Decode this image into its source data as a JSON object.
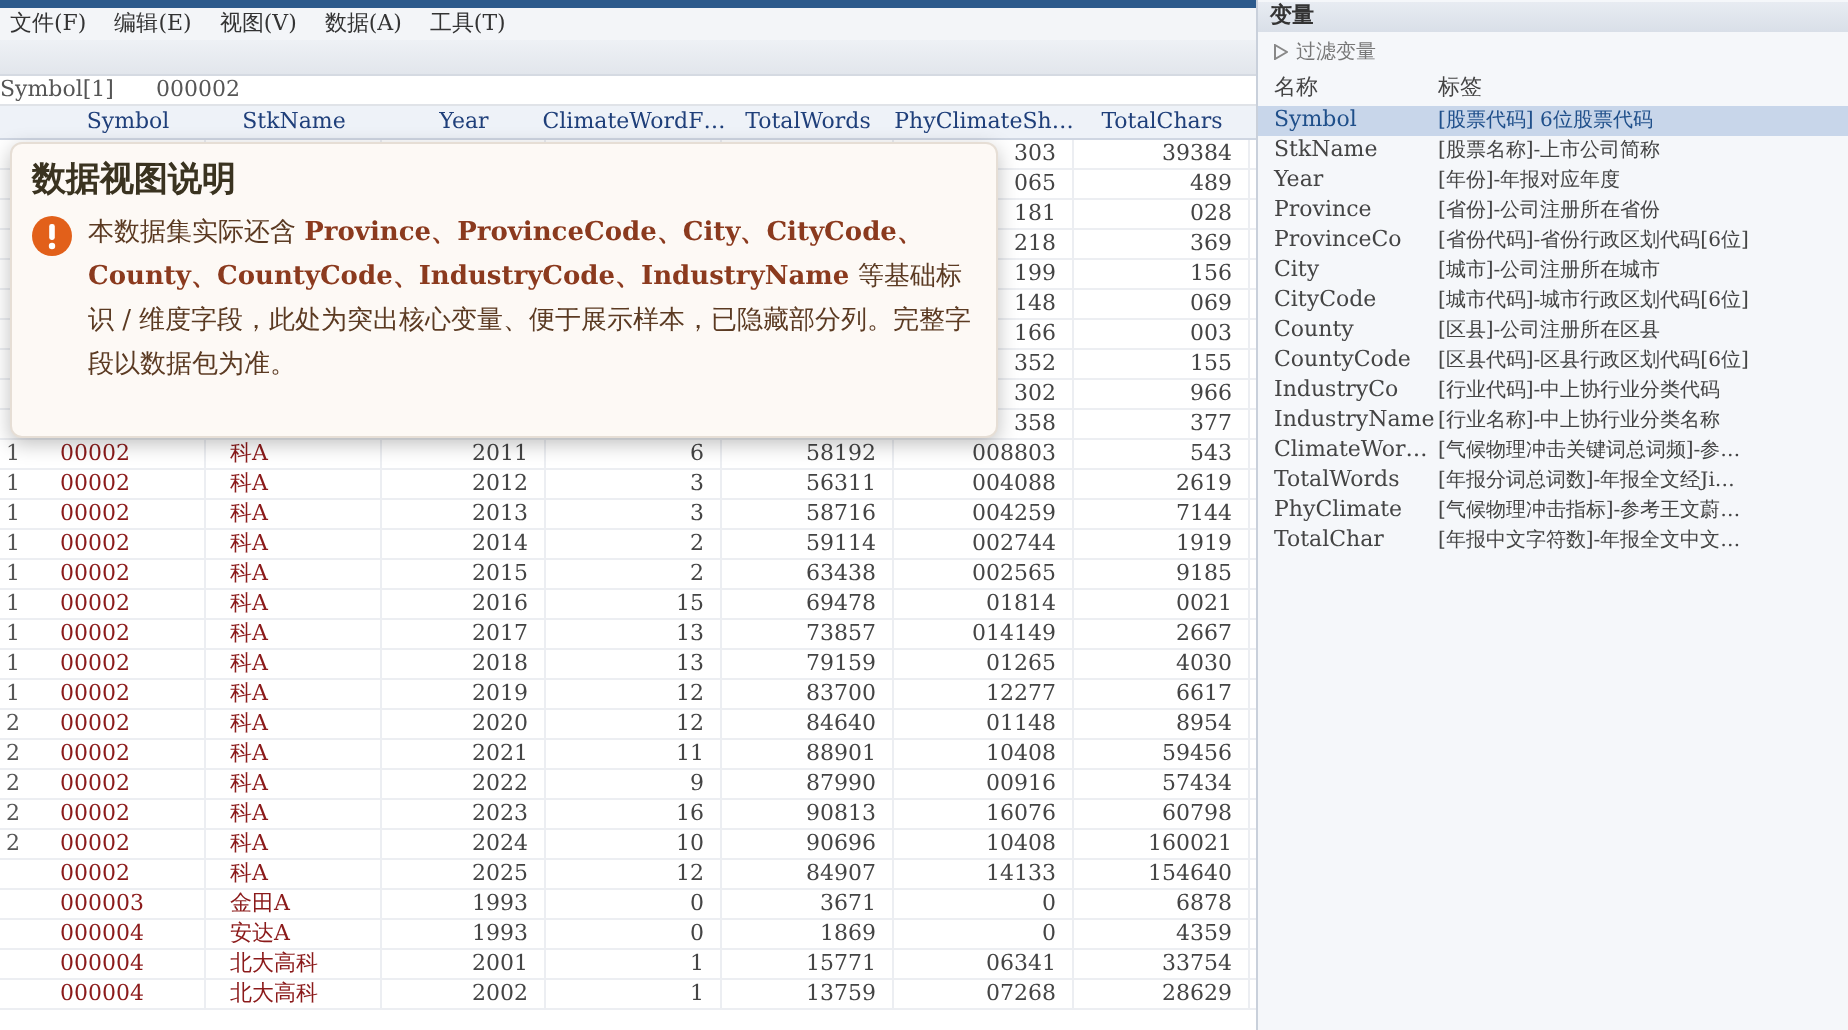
{
  "menu": [
    "文件(F)",
    "编辑(E)",
    "视图(V)",
    "数据(A)",
    "工具(T)"
  ],
  "cell_editor": {
    "name": "Symbol[1]",
    "value": "000002"
  },
  "table": {
    "columns": [
      "Symbol",
      "StkName",
      "Year",
      "ClimateWordF…",
      "TotalWords",
      "PhyClimateSh…",
      "TotalChars"
    ],
    "rows": [
      {
        "phy": "303",
        "chars": "39384"
      },
      {
        "phy": "065",
        "chars": "489"
      },
      {
        "phy": "181",
        "chars": "028"
      },
      {
        "phy": "218",
        "chars": "369"
      },
      {
        "phy": "199",
        "chars": "156"
      },
      {
        "phy": "148",
        "chars": "069"
      },
      {
        "phy": "166",
        "chars": "003"
      },
      {
        "phy": "352",
        "chars": "155"
      },
      {
        "phy": "302",
        "chars": "966"
      },
      {
        "phy": "358",
        "chars": "377"
      },
      {
        "no": "1",
        "symbol": "00002",
        "name": "科A",
        "year": "2011",
        "climate": "6",
        "words": "58192",
        "phy": "008803",
        "chars": "543"
      },
      {
        "no": "1",
        "symbol": "00002",
        "name": "科A",
        "year": "2012",
        "climate": "3",
        "words": "56311",
        "phy": "004088",
        "chars": "2619"
      },
      {
        "no": "1",
        "symbol": "00002",
        "name": "科A",
        "year": "2013",
        "climate": "3",
        "words": "58716",
        "phy": "004259",
        "chars": "7144"
      },
      {
        "no": "1",
        "symbol": "00002",
        "name": "科A",
        "year": "2014",
        "climate": "2",
        "words": "59114",
        "phy": "002744",
        "chars": "1919"
      },
      {
        "no": "1",
        "symbol": "00002",
        "name": "科A",
        "year": "2015",
        "climate": "2",
        "words": "63438",
        "phy": "002565",
        "chars": "9185"
      },
      {
        "no": "1",
        "symbol": "00002",
        "name": "科A",
        "year": "2016",
        "climate": "15",
        "words": "69478",
        "phy": "01814",
        "chars": "0021"
      },
      {
        "no": "1",
        "symbol": "00002",
        "name": "科A",
        "year": "2017",
        "climate": "13",
        "words": "73857",
        "phy": "014149",
        "chars": "2667"
      },
      {
        "no": "1",
        "symbol": "00002",
        "name": "科A",
        "year": "2018",
        "climate": "13",
        "words": "79159",
        "phy": "01265",
        "chars": "4030"
      },
      {
        "no": "1",
        "symbol": "00002",
        "name": "科A",
        "year": "2019",
        "climate": "12",
        "words": "83700",
        "phy": "12277",
        "chars": "6617"
      },
      {
        "no": "2",
        "symbol": "00002",
        "name": "科A",
        "year": "2020",
        "climate": "12",
        "words": "84640",
        "phy": "01148",
        "chars": "8954"
      },
      {
        "no": "2",
        "symbol": "00002",
        "name": "科A",
        "year": "2021",
        "climate": "11",
        "words": "88901",
        "phy": "10408",
        "chars": "59456"
      },
      {
        "no": "2",
        "symbol": "00002",
        "name": "科A",
        "year": "2022",
        "climate": "9",
        "words": "87990",
        "phy": "00916",
        "chars": "57434"
      },
      {
        "no": "2",
        "symbol": "00002",
        "name": "科A",
        "year": "2023",
        "climate": "16",
        "words": "90813",
        "phy": "16076",
        "chars": "60798"
      },
      {
        "no": "2",
        "symbol": "00002",
        "name": "科A",
        "year": "2024",
        "climate": "10",
        "words": "90696",
        "phy": "10408",
        "chars": "160021"
      },
      {
        "symbol": "00002",
        "name": "科A",
        "year": "2025",
        "climate": "12",
        "words": "84907",
        "phy": "14133",
        "chars": "154640"
      },
      {
        "symbol": "000003",
        "name": "金田A",
        "year": "1993",
        "climate": "0",
        "words": "3671",
        "phy": "0",
        "chars": "6878"
      },
      {
        "symbol": "000004",
        "name": "安达A",
        "year": "1993",
        "climate": "0",
        "words": "1869",
        "phy": "0",
        "chars": "4359"
      },
      {
        "symbol": "000004",
        "name": "北大高科",
        "year": "2001",
        "climate": "1",
        "words": "15771",
        "phy": "06341",
        "chars": "33754"
      },
      {
        "symbol": "000004",
        "name": "北大高科",
        "year": "2002",
        "climate": "1",
        "words": "13759",
        "phy": "07268",
        "chars": "28629"
      }
    ]
  },
  "notice": {
    "title": "数据视图说明",
    "body": "本数据集实际还含 **Province、ProvinceCode、City、CityCode、County、CountyCode、IndustryCode、IndustryName** 等基础标识 / 维度字段，此处为突出核心变量、便于展示样本，已隐藏部分列。完整字段以数据包为准。"
  },
  "variables": {
    "title": "变量",
    "filter": "过滤变量",
    "columns": [
      "名称",
      "标签"
    ],
    "items": [
      {
        "name": "Symbol",
        "label": "[股票代码] 6位股票代码",
        "selected": true
      },
      {
        "name": "StkName",
        "label": "[股票名称]-上市公司简称",
        "selected": false
      },
      {
        "name": "Year",
        "label": "[年份]-年报对应年度",
        "selected": false
      },
      {
        "name": "Province",
        "label": "[省份]-公司注册所在省份",
        "selected": false
      },
      {
        "name": "ProvinceCo",
        "label": "[省份代码]-省份行政区划代码[6位]",
        "selected": false
      },
      {
        "name": "City",
        "label": "[城市]-公司注册所在城市",
        "selected": false
      },
      {
        "name": "CityCode",
        "label": "[城市代码]-城市行政区划代码[6位]",
        "selected": false
      },
      {
        "name": "County",
        "label": "[区县]-公司注册所在区县",
        "selected": false
      },
      {
        "name": "CountyCode",
        "label": "[区县代码]-区县行政区划代码[6位]",
        "selected": false
      },
      {
        "name": "IndustryCo",
        "label": "[行业代码]-中上协行业分类代码",
        "selected": false
      },
      {
        "name": "IndustryName",
        "label": "[行业名称]-中上协行业分类名称",
        "selected": false
      },
      {
        "name": "ClimateWor…",
        "label": "[气候物理冲击关键词总词频]-参…",
        "selected": false
      },
      {
        "name": "TotalWords",
        "label": "[年报分词总词数]-年报全文经Ji…",
        "selected": false
      },
      {
        "name": "PhyClimate",
        "label": "[气候物理冲击指标]-参考王文蔚…",
        "selected": false
      },
      {
        "name": "TotalChar",
        "label": "[年报中文字符数]-年报全文中文…",
        "selected": false
      }
    ]
  }
}
